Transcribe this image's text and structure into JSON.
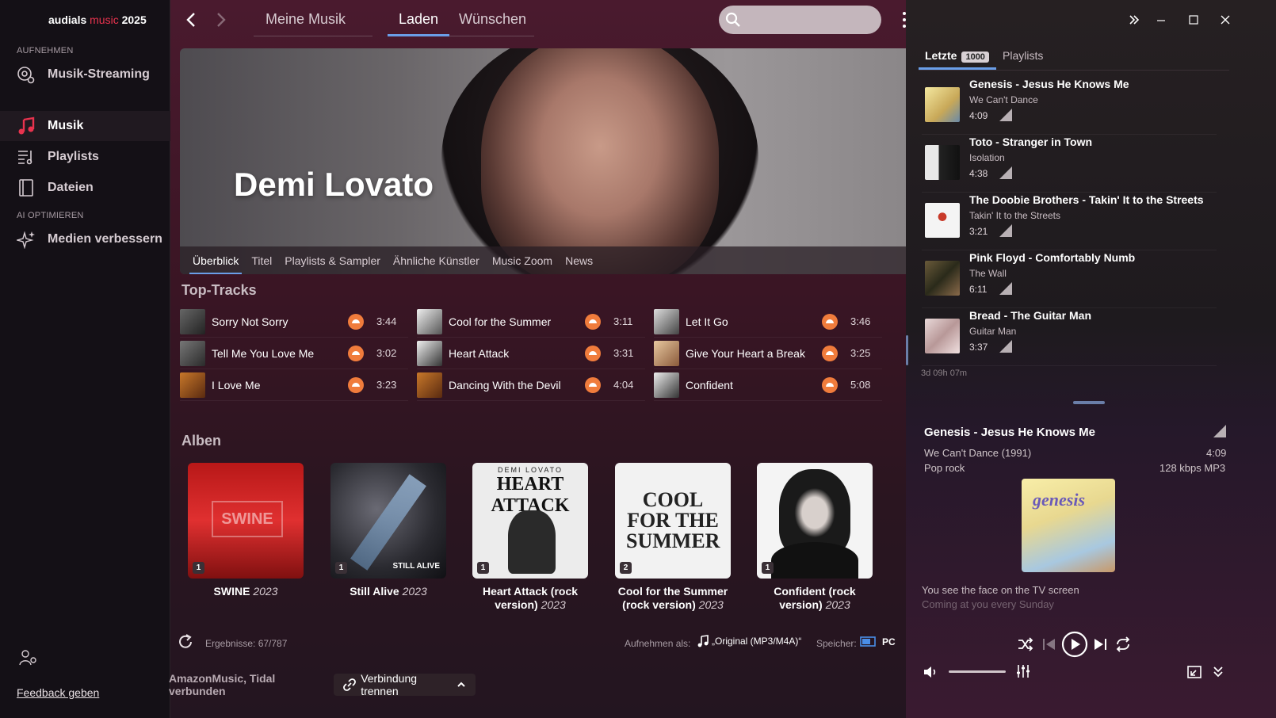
{
  "app": {
    "name_main": "audials",
    "name_accent": "music",
    "name_year": "2025"
  },
  "sidebar": {
    "section_record": "AUFNEHMEN",
    "streaming": "Musik-Streaming",
    "music": "Musik",
    "playlists": "Playlists",
    "files": "Dateien",
    "section_ai": "AI OPTIMIEREN",
    "improve": "Medien verbessern",
    "feedback": "Feedback geben"
  },
  "top_tabs": [
    "Meine Musik",
    "Laden",
    "Wünschen"
  ],
  "hero": {
    "artist": "Demi Lovato",
    "tabs": [
      "Überblick",
      "Titel",
      "Playlists & Sampler",
      "Ähnliche Künstler",
      "Music Zoom",
      "News"
    ]
  },
  "top_tracks": {
    "title": "Top-Tracks",
    "columns": [
      [
        {
          "name": "Sorry Not Sorry",
          "duration": "3:44"
        },
        {
          "name": "Tell Me You Love Me",
          "duration": "3:02"
        },
        {
          "name": "I Love Me",
          "duration": "3:23"
        }
      ],
      [
        {
          "name": "Cool for the Summer",
          "duration": "3:11"
        },
        {
          "name": "Heart Attack",
          "duration": "3:31"
        },
        {
          "name": "Dancing With the Devil",
          "duration": "4:04"
        }
      ],
      [
        {
          "name": "Let It Go",
          "duration": "3:46"
        },
        {
          "name": "Give Your Heart a Break",
          "duration": "3:25"
        },
        {
          "name": "Confident",
          "duration": "5:08"
        }
      ]
    ]
  },
  "albums": {
    "title": "Alben",
    "items": [
      {
        "title": "SWINE",
        "year": "2023",
        "badge": "1",
        "cover_text": "SWINE"
      },
      {
        "title": "Still Alive",
        "year": "2023",
        "badge": "1",
        "cover_text": "STILL ALIVE"
      },
      {
        "title": "Heart Attack (rock version)",
        "year": "2023",
        "badge": "1",
        "cover_text": "HEART ATTACK",
        "cover_small": "DEMI LOVATO"
      },
      {
        "title": "Cool for the Summer (rock version)",
        "year": "2023",
        "badge": "2",
        "cover_text": "COOL FOR THE SUMMER"
      },
      {
        "title": "Confident (rock version)",
        "year": "2023",
        "badge": "1",
        "cover_text": ""
      }
    ]
  },
  "footer": {
    "results": "Ergebnisse: 67/787",
    "record_as_label": "Aufnehmen als:",
    "record_as_value": "„Original (MP3/M4A)“",
    "save_label": "Speicher:",
    "save_value": "PC",
    "connected": "AmazonMusic, Tidal verbunden",
    "disconnect": "Verbindung trennen"
  },
  "right": {
    "tab_recent": "Letzte",
    "recent_count": "1000",
    "tab_playlists": "Playlists",
    "items": [
      {
        "title": "Genesis - Jesus He Knows Me",
        "album": "We Can't Dance",
        "duration": "4:09"
      },
      {
        "title": "Toto - Stranger in Town",
        "album": "Isolation",
        "duration": "4:38"
      },
      {
        "title": "The Doobie Brothers - Takin' It to the Streets",
        "album": "Takin' It to the Streets",
        "duration": "3:21"
      },
      {
        "title": "Pink Floyd - Comfortably Numb",
        "album": "The Wall",
        "duration": "6:11"
      },
      {
        "title": "Bread - The Guitar Man",
        "album": "Guitar Man",
        "duration": "3:37"
      }
    ],
    "total_time": "3d 09h 07m",
    "now_playing": {
      "title": "Genesis -  Jesus He Knows Me",
      "album": "We Can't Dance  (1991)",
      "duration": "4:09",
      "genre": "Pop rock",
      "quality": "128 kbps MP3",
      "cover_text": "genesis",
      "lyrics": [
        "You see the face on the TV screen",
        "Coming at you every Sunday"
      ]
    }
  },
  "colors": {
    "accent": "#6a9ee8",
    "brand_red": "#e8334e",
    "source_orange": "#f07c3c"
  }
}
